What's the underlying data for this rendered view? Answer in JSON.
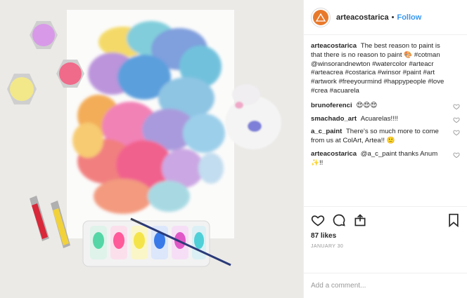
{
  "header": {
    "username": "arteacostarica",
    "separator": "•",
    "follow_label": "Follow",
    "avatar_text": "ARTEA"
  },
  "caption": {
    "username": "arteacostarica",
    "text": "The best reason to paint is that there is no reason to paint 🎨 #cotman @winsorandnewton #watercolor #arteacr #arteacrea #costarica #winsor #paint #art #artwork #freeyourmind #happypeople #love #crea #acuarela"
  },
  "comments": [
    {
      "username": "brunoferenci",
      "text": "😍😍😍"
    },
    {
      "username": "smachado_art",
      "text": "Acuarelas!!!!"
    },
    {
      "username": "a_c_paint",
      "text": "There's so much more to come from us at ColArt, Artea!! 🙂"
    },
    {
      "username": "arteacostarica",
      "text": "@a_c_paint thanks Anum ✨!!"
    }
  ],
  "likes": "87 likes",
  "date": "JANUARY 30",
  "add_comment_placeholder": "Add a comment...",
  "icons": {
    "like": "heart-icon",
    "comment": "comment-icon",
    "share": "share-icon",
    "save": "bookmark-icon"
  },
  "colors": {
    "follow": "#3897f0",
    "avatar": "#e8792b"
  }
}
